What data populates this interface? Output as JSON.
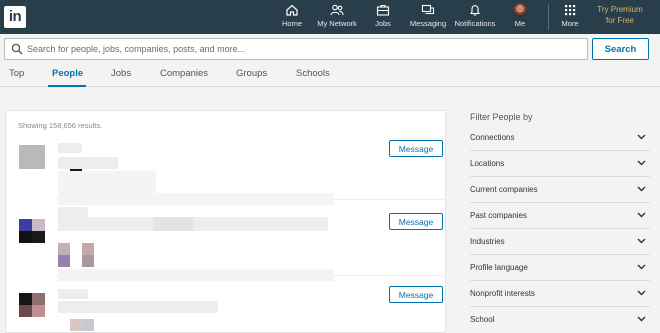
{
  "nav": {
    "logo": "in",
    "items": [
      {
        "label": "Home",
        "icon": "home-icon"
      },
      {
        "label": "My Network",
        "icon": "network-icon"
      },
      {
        "label": "Jobs",
        "icon": "briefcase-icon"
      },
      {
        "label": "Messaging",
        "icon": "messaging-icon"
      },
      {
        "label": "Notifications",
        "icon": "bell-icon"
      },
      {
        "label": "Me",
        "icon": "avatar"
      },
      {
        "label": "More",
        "icon": "grid-icon"
      }
    ],
    "premium_line1": "Try Premium",
    "premium_line2": "for Free"
  },
  "search": {
    "placeholder": "Search for people, jobs, companies, posts, and more...",
    "button": "Search"
  },
  "tabs": [
    {
      "label": "Top",
      "active": false
    },
    {
      "label": "People",
      "active": true
    },
    {
      "label": "Jobs",
      "active": false
    },
    {
      "label": "Companies",
      "active": false
    },
    {
      "label": "Groups",
      "active": false
    },
    {
      "label": "Schools",
      "active": false
    }
  ],
  "results": {
    "count_text": "Showing 158,656 results.",
    "message_label": "Message"
  },
  "filters": {
    "title": "Filter People by",
    "items": [
      "Connections",
      "Locations",
      "Current companies",
      "Past companies",
      "Industries",
      "Profile language",
      "Nonprofit interests",
      "School"
    ]
  },
  "colors": {
    "nav_bg": "#283e4a",
    "accent": "#0073b1",
    "premium": "#d8b56c"
  }
}
